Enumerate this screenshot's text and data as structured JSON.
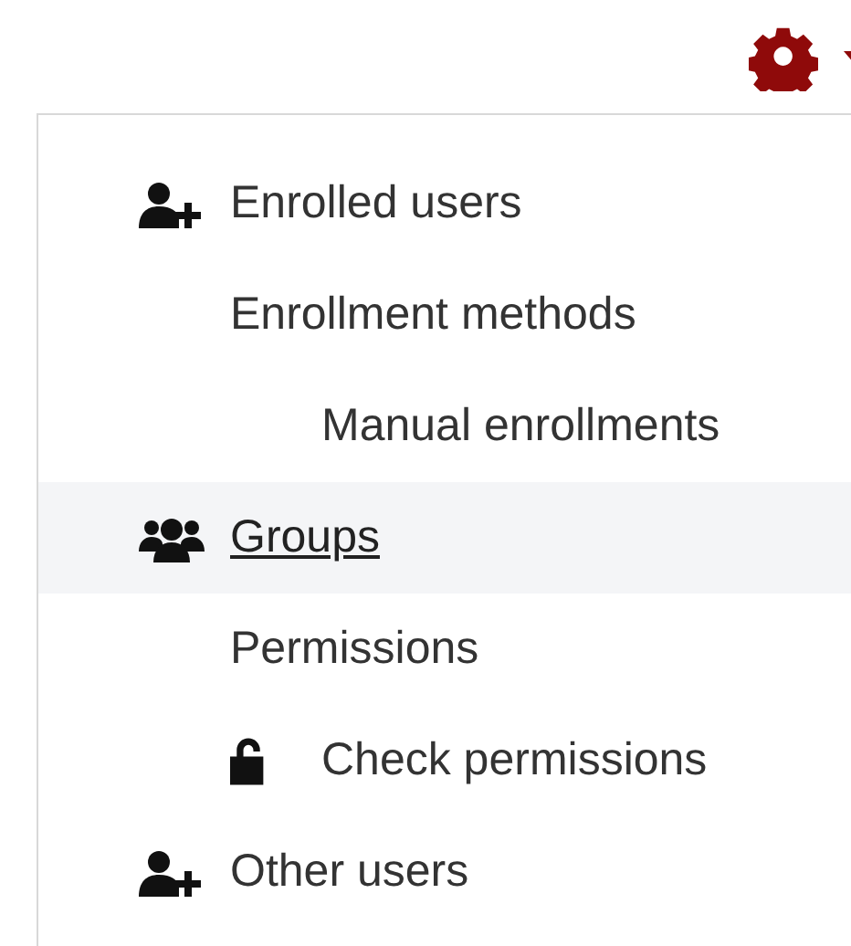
{
  "menu": {
    "items": [
      {
        "label": "Enrolled users",
        "kind": "person-add",
        "selected": false
      },
      {
        "label": "Enrollment methods",
        "kind": "plain",
        "selected": false,
        "children": [
          {
            "label": "Manual enrollments",
            "kind": "plain",
            "selected": false
          }
        ]
      },
      {
        "label": "Groups",
        "kind": "group",
        "selected": true
      },
      {
        "label": "Permissions",
        "kind": "plain",
        "selected": false,
        "children": [
          {
            "label": "Check permissions",
            "kind": "unlocked",
            "selected": false
          }
        ]
      },
      {
        "label": "Other users",
        "kind": "person-add",
        "selected": false
      }
    ]
  }
}
